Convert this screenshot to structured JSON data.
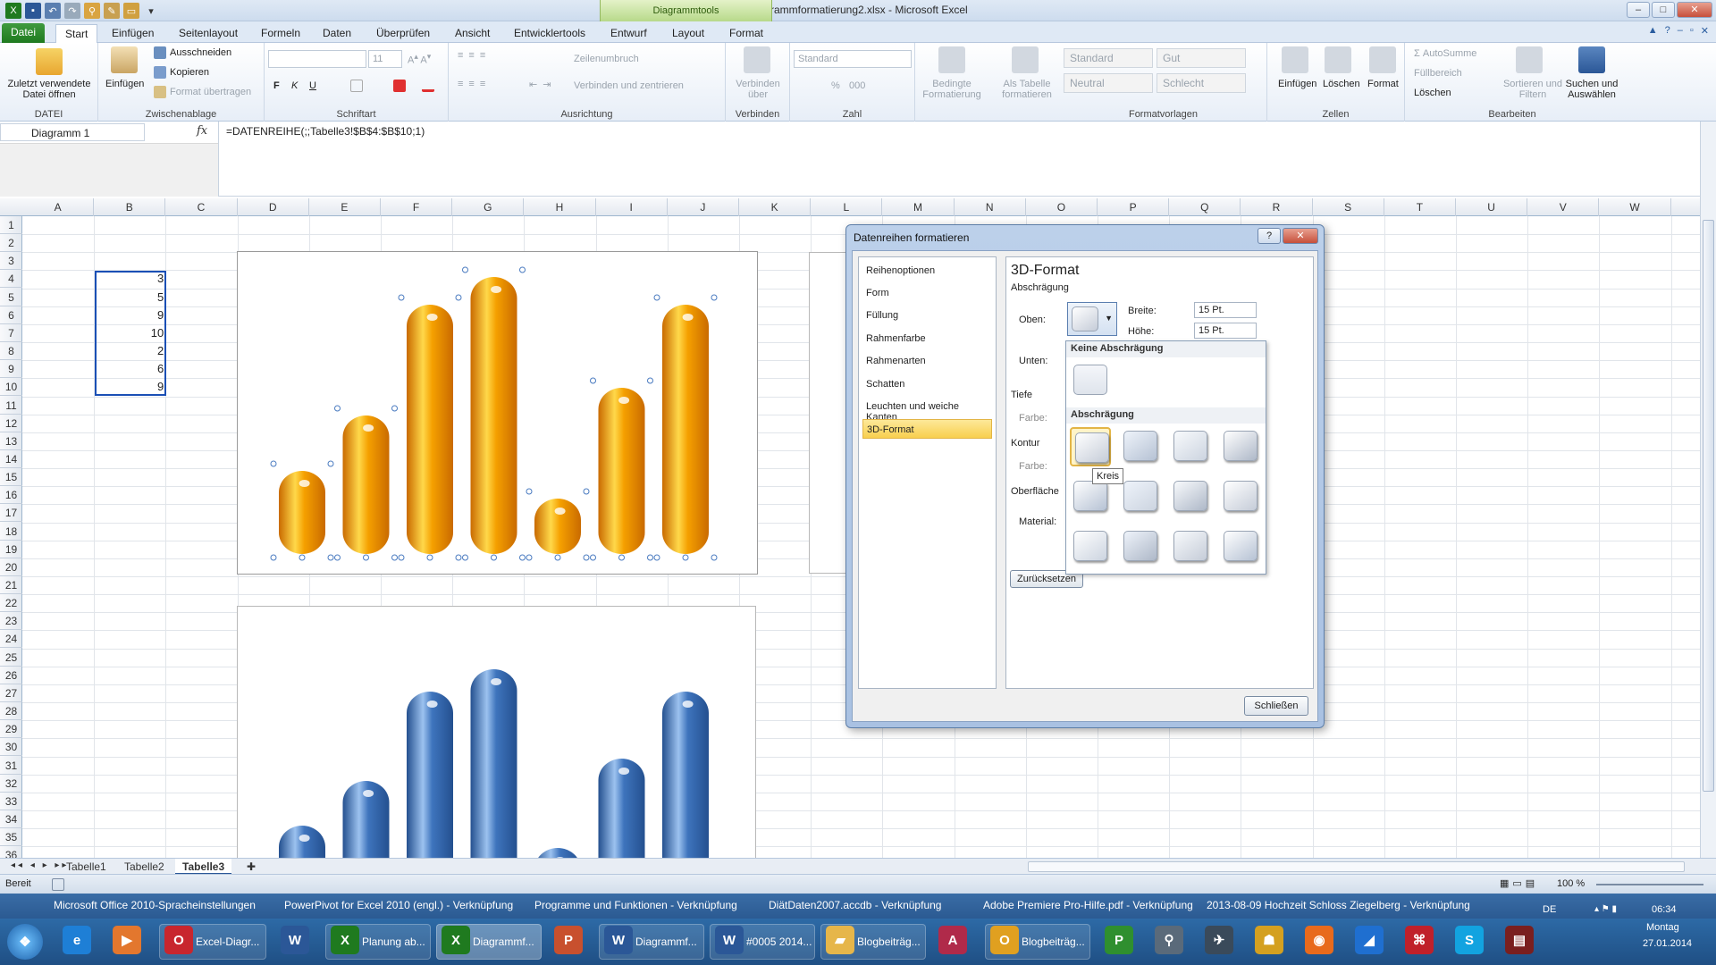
{
  "window": {
    "title": "Diagrammformatierung2.xlsx - Microsoft Excel",
    "context_tab": "Diagrammtools"
  },
  "tabs": [
    "Datei",
    "Start",
    "Einfügen",
    "Seitenlayout",
    "Formeln",
    "Daten",
    "Überprüfen",
    "Ansicht",
    "Entwicklertools",
    "Entwurf",
    "Layout",
    "Format"
  ],
  "ribbon": {
    "datei": {
      "label": "Zuletzt verwendete Datei öffnen",
      "group": "DATEI"
    },
    "clipboard": {
      "paste": "Einfügen",
      "cut": "Ausschneiden",
      "copy": "Kopieren",
      "painter": "Format übertragen",
      "group": "Zwischenablage"
    },
    "font": {
      "size": "11",
      "bold": "F",
      "italic": "K",
      "underline": "U",
      "group": "Schriftart"
    },
    "align": {
      "wrap": "Zeilenumbruch",
      "merge": "Verbinden und zentrieren",
      "group": "Ausrichtung"
    },
    "connect": {
      "label": "Verbinden über",
      "group": "Verbinden"
    },
    "number": {
      "format": "Standard",
      "percent": "%",
      "thousands": "000",
      "group": "Zahl"
    },
    "cond": {
      "label": "Bedingte Formatierung"
    },
    "astable": {
      "label": "Als Tabelle formatieren"
    },
    "styles": {
      "standard": "Standard",
      "gut": "Gut",
      "neutral": "Neutral",
      "schlecht": "Schlecht",
      "group": "Formatvorlagen"
    },
    "cells": {
      "insert": "Einfügen",
      "delete": "Löschen",
      "format": "Format",
      "group": "Zellen"
    },
    "edit": {
      "autosum": "AutoSumme",
      "fill": "Füllbereich",
      "clear": "Löschen",
      "sort": "Sortieren und Filtern",
      "find": "Suchen und Auswählen",
      "group": "Bearbeiten"
    }
  },
  "formula": {
    "namebox": "Diagramm 1",
    "fx": "fx",
    "text": "=DATENREIHE(;;Tabelle3!$B$4:$B$10;1)"
  },
  "columns": [
    "A",
    "B",
    "C",
    "D",
    "E",
    "F",
    "G",
    "H",
    "I",
    "J",
    "K",
    "L",
    "M",
    "N",
    "O",
    "P",
    "Q",
    "R",
    "S",
    "T",
    "U",
    "V",
    "W"
  ],
  "rows": [
    "1",
    "2",
    "3",
    "4",
    "5",
    "6",
    "7",
    "8",
    "9",
    "10",
    "11",
    "12",
    "13",
    "14",
    "15",
    "16",
    "17",
    "18",
    "19",
    "20",
    "21",
    "22",
    "23",
    "24",
    "25",
    "26",
    "27",
    "28",
    "29",
    "30",
    "31",
    "32",
    "33",
    "34",
    "35",
    "36"
  ],
  "cells": [
    "3",
    "5",
    "9",
    "10",
    "2",
    "6",
    "9"
  ],
  "chart_data": [
    {
      "type": "bar",
      "values": [
        3,
        5,
        9,
        10,
        2,
        6,
        9
      ],
      "style": "3D cylinder",
      "color": "#f5a000"
    },
    {
      "type": "bar",
      "values": [
        3,
        5,
        9,
        10,
        2,
        6,
        9
      ],
      "style": "3D cylinder",
      "color": "#3e74bd"
    }
  ],
  "dialog": {
    "title": "Datenreihen formatieren",
    "help": "?",
    "close": "✕",
    "nav": [
      "Reihenoptionen",
      "Form",
      "Füllung",
      "Rahmenfarbe",
      "Rahmenarten",
      "Schatten",
      "Leuchten und weiche Kanten",
      "3D-Format"
    ],
    "panel": {
      "heading": "3D-Format",
      "section": "Abschrägung",
      "oben": "Oben:",
      "unten": "Unten:",
      "breite": "Breite:",
      "hoehe": "Höhe:",
      "breite_val": "15 Pt.",
      "hoehe_val": "15 Pt.",
      "tiefe": "Tiefe",
      "farbe1": "Farbe:",
      "kontur": "Kontur",
      "farbe2": "Farbe:",
      "oberflaeche": "Oberfläche",
      "material": "Material:",
      "reset": "Zurücksetzen"
    },
    "close_button": "Schließen"
  },
  "gallery": {
    "none_head": "Keine Abschrägung",
    "bevel_head": "Abschrägung",
    "tooltip": "Kreis"
  },
  "sheets": [
    "Tabelle1",
    "Tabelle2",
    "Tabelle3"
  ],
  "status": {
    "ready": "Bereit",
    "zoom": "100 %"
  },
  "quicklinks": [
    "Microsoft Office 2010-Spracheinstellungen",
    "PowerPivot for Excel 2010 (engl.) - Verknüpfung",
    "Programme und Funktionen - Verknüpfung",
    "DiätDaten2007.accdb - Verknüpfung",
    "Adobe Premiere Pro-Hilfe.pdf - Verknüpfung",
    "2013-08-09 Hochzeit Schloss Ziegelberg - Verknüpfung"
  ],
  "taskbar": {
    "buttons": [
      "Excel-Diagr...",
      "Planung ab...",
      "Diagrammf...",
      "Diagrammf...",
      "#0005 2014...",
      "Blogbeiträg...",
      "Blogbeiträg..."
    ],
    "lang": "DE",
    "time": "06:34",
    "day": "Montag",
    "date": "27.01.2014"
  }
}
